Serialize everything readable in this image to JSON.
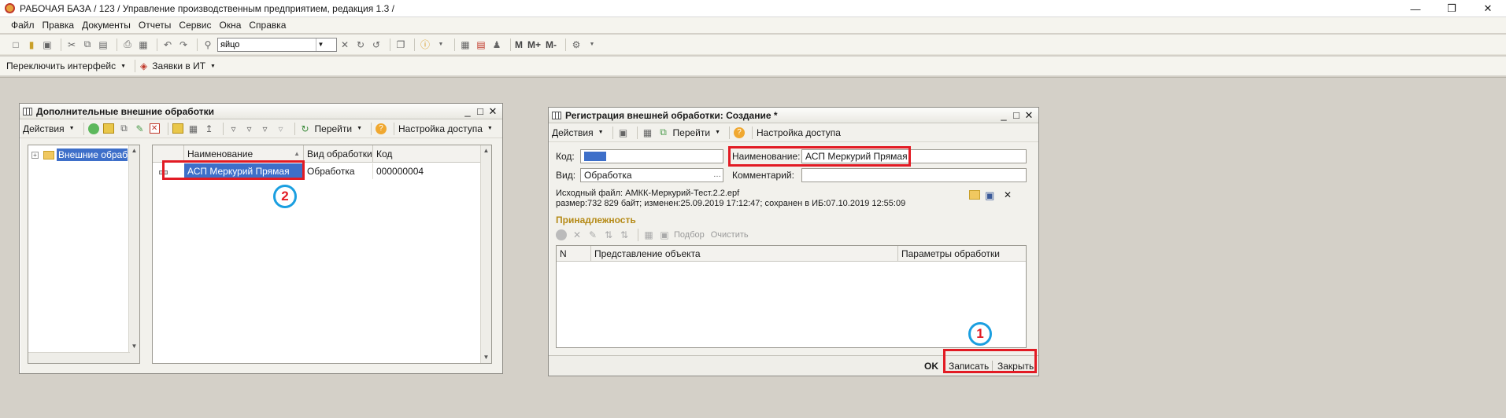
{
  "app": {
    "title": "РАБОЧАЯ БАЗА / 123 /  Управление производственным предприятием, редакция 1.3 /",
    "window_controls": [
      "—",
      "❒",
      "✕"
    ]
  },
  "menu": [
    "Файл",
    "Правка",
    "Документы",
    "Отчеты",
    "Сервис",
    "Окна",
    "Справка"
  ],
  "toolbar": {
    "search_value": "яйцо",
    "m_labels": [
      "M",
      "M+",
      "M-"
    ]
  },
  "toolbar2": {
    "switch_interface": "Переключить интерфейс",
    "it_requests": "Заявки в ИТ"
  },
  "window1": {
    "title": "Дополнительные внешние обработки",
    "actions": "Действия",
    "goto": "Перейти",
    "access": "Настройка доступа",
    "tree": {
      "root": "Внешние обработки"
    },
    "columns": [
      "Наименование",
      "Вид обработки",
      "Код"
    ],
    "rows": [
      {
        "name": "АСП Меркурий Прямая",
        "kind": "Обработка",
        "code": "000000004"
      }
    ],
    "badge": "2"
  },
  "window2": {
    "title": "Регистрация внешней обработки: Создание *",
    "actions": "Действия",
    "goto": "Перейти",
    "access": "Настройка доступа",
    "code_label": "Код:",
    "name_label": "Наименование:",
    "name_value": "АСП Меркурий Прямая",
    "kind_label": "Вид:",
    "kind_value": "Обработка",
    "comment_label": "Комментарий:",
    "comment_value": "",
    "source_line1": "Исходный файл: АМКК-Меркурий-Тест.2.2.epf",
    "source_line2": "размер:732 829 байт; изменен:25.09.2019 17:12:47; сохранен в ИБ:07.10.2019 12:55:09",
    "section": "Принадлежность",
    "selection": "Подбор",
    "clear": "Очистить",
    "columns": [
      "N",
      "Представление объекта",
      "Параметры обработки"
    ],
    "ok": "OK",
    "save": "Записать",
    "close": "Закрыть",
    "badge": "1"
  },
  "colors": {
    "accent_blue": "#3e6fc9",
    "highlight_red": "#e21b24",
    "badge_ring": "#1b9fe0",
    "section_gold": "#b58a16"
  }
}
